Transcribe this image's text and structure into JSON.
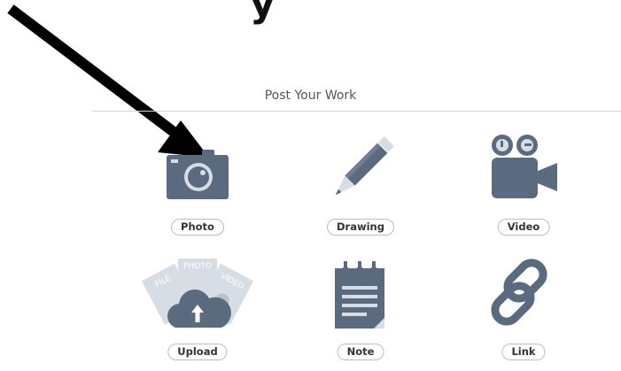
{
  "header": {
    "partial_heading": "y"
  },
  "section": {
    "title": "Post Your Work"
  },
  "options": [
    {
      "label": "Photo"
    },
    {
      "label": "Drawing"
    },
    {
      "label": "Video"
    },
    {
      "label": "Upload"
    },
    {
      "label": "Note"
    },
    {
      "label": "Link"
    }
  ],
  "upload_icon": {
    "card_left": "FILE",
    "card_middle": "PHOTO",
    "card_right": "VIDEO"
  },
  "colors": {
    "icon": "#5b6b7f",
    "icon_light": "#d7dde5",
    "arrow": "#000000"
  }
}
